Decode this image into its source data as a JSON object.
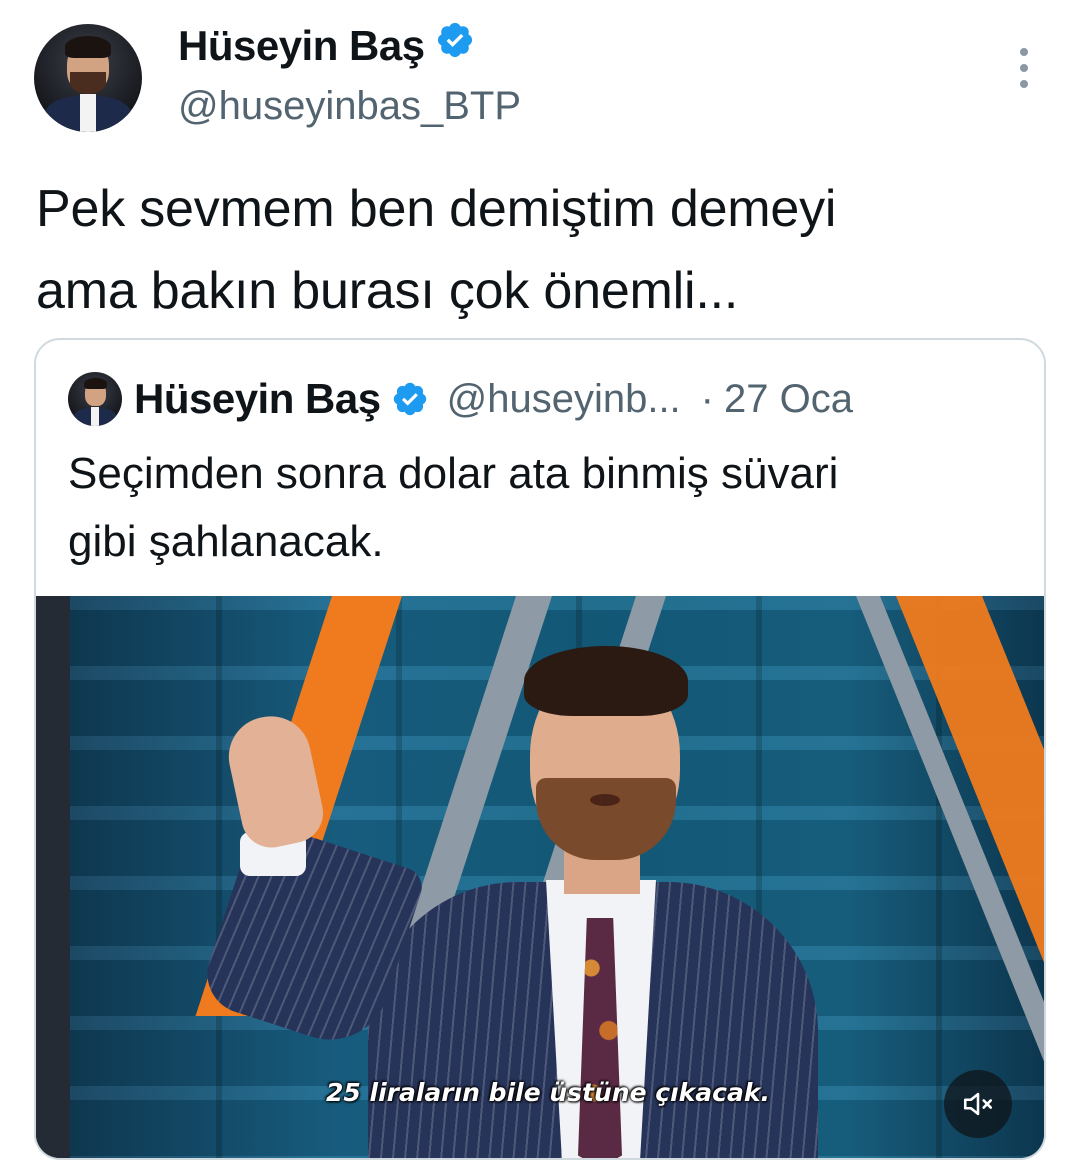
{
  "tweet": {
    "author": {
      "name": "Hüseyin Baş",
      "handle": "@huseyinbas_BTP"
    },
    "text_line1": "Pek sevmem ben demiştim demeyi",
    "text_line2": "ama bakın burası çok önemli..."
  },
  "quoted_tweet": {
    "name": "Hüseyin Baş",
    "handle": "@huseyinb...",
    "separator": "·",
    "date": "27 Oca",
    "text_line1": "Seçimden sonra dolar ata binmiş süvari",
    "text_line2": "gibi şahlanacak.",
    "media": {
      "subtitle": "25 liraların bile üstüne çıkacak.",
      "mute_icon": "volume-muted-icon"
    }
  },
  "icons": {
    "verified": "verified-badge-icon",
    "more": "more-vertical-icon"
  },
  "colors": {
    "verified_blue": "#1d9bf0",
    "secondary_text": "#536471",
    "border": "#cfd9de"
  }
}
